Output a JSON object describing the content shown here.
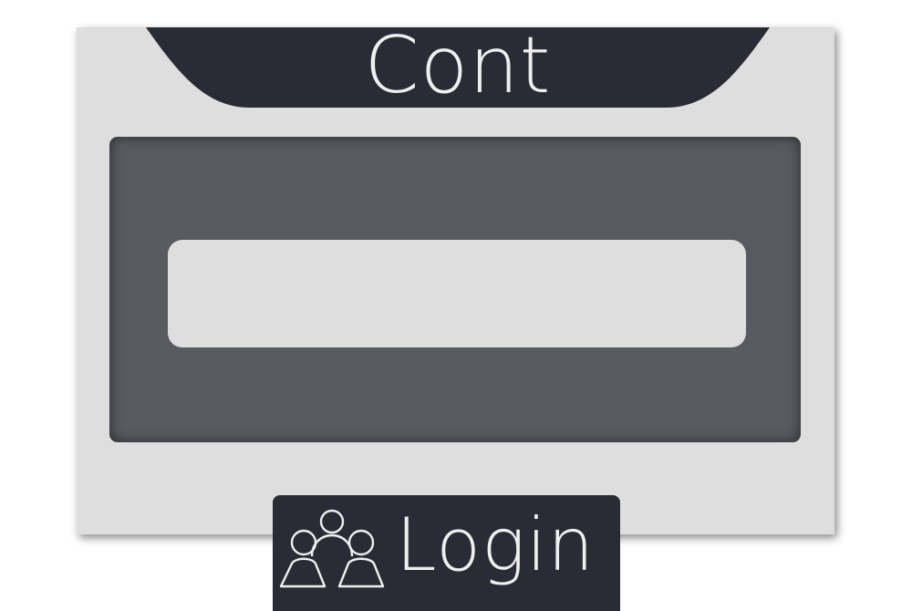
{
  "header": {
    "title": "Cont"
  },
  "login": {
    "label": "Login",
    "icon": "users-group-icon"
  },
  "colors": {
    "background": "#ffffff",
    "card": "#dedede",
    "dark": "#2a2c35",
    "panel": "#585a62",
    "text_light": "#efefef"
  }
}
